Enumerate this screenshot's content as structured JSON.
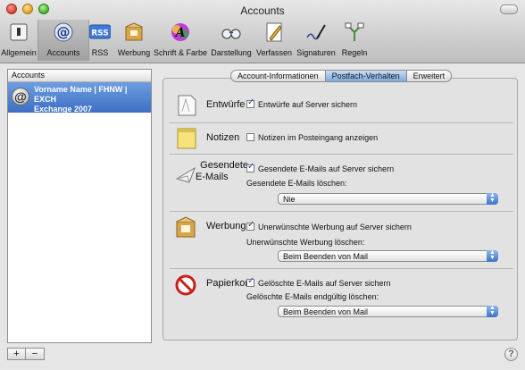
{
  "window": {
    "title": "Accounts"
  },
  "toolbar": {
    "items": [
      {
        "label": "Allgemein",
        "icon": "switch-icon"
      },
      {
        "label": "Accounts",
        "icon": "at-sign-icon",
        "selected": true
      },
      {
        "label": "RSS",
        "icon": "rss-icon"
      },
      {
        "label": "Werbung",
        "icon": "junk-mail-icon"
      },
      {
        "label": "Schrift & Farbe",
        "icon": "font-color-icon"
      },
      {
        "label": "Darstellung",
        "icon": "glasses-icon"
      },
      {
        "label": "Verfassen",
        "icon": "compose-pencil-icon"
      },
      {
        "label": "Signaturen",
        "icon": "signature-pen-icon"
      },
      {
        "label": "Regeln",
        "icon": "rules-icon"
      }
    ],
    "rss_text": "RSS"
  },
  "accounts_list": {
    "header": "Accounts",
    "items": [
      {
        "line1": "Vorname Name | FHNW | EXCH",
        "line2": "Exchange 2007",
        "icon_glyph": "@"
      }
    ]
  },
  "buttons": {
    "add": "+",
    "remove": "−",
    "help": "?"
  },
  "tabs": [
    {
      "label": "Account-Informationen",
      "active": false
    },
    {
      "label": "Postfach-Verhalten",
      "active": true
    },
    {
      "label": "Erweitert",
      "active": false
    }
  ],
  "sections": {
    "drafts": {
      "title": "Entwürfe",
      "checkbox": "Entwürfe auf Server sichern",
      "checked": true
    },
    "notes": {
      "title": "Notizen",
      "checkbox": "Notizen im Posteingang anzeigen",
      "checked": false
    },
    "sent": {
      "title_line1": "Gesendete",
      "title_line2": "E-Mails",
      "checkbox": "Gesendete E-Mails auf Server sichern",
      "checked": true,
      "delete_label": "Gesendete E-Mails löschen:",
      "delete_value": "Nie"
    },
    "junk": {
      "title": "Werbung",
      "checkbox": "Unerwünschte Werbung auf Server sichern",
      "checked": true,
      "delete_label": "Unerwünschte Werbung löschen:",
      "delete_value": "Beim Beenden von Mail"
    },
    "trash": {
      "title": "Papierkorb",
      "checkbox": "Gelöschte E-Mails auf Server sichern",
      "checked": true,
      "delete_label": "Gelöschte E-Mails endgültig löschen:",
      "delete_value": "Beim Beenden von Mail"
    }
  }
}
